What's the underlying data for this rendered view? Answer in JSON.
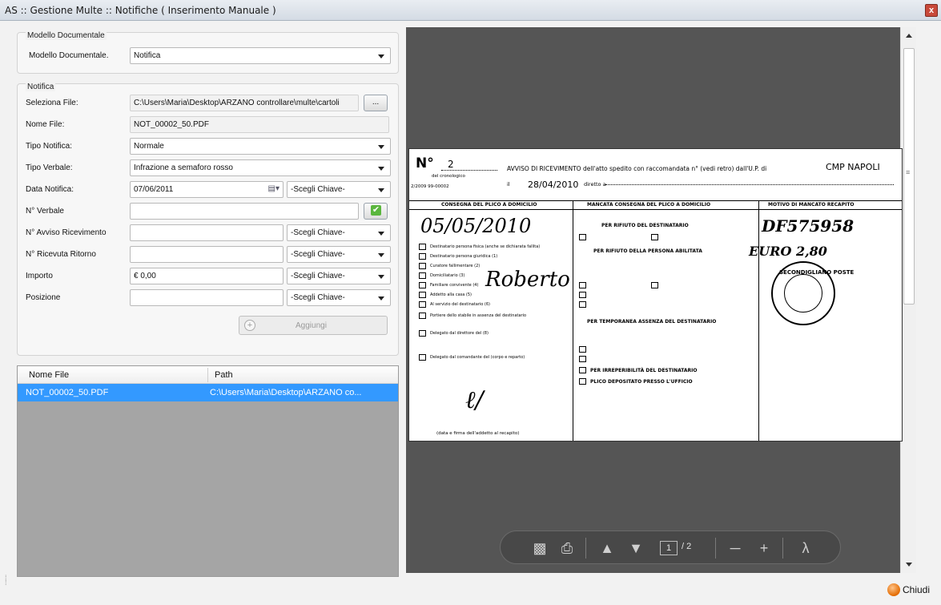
{
  "window": {
    "title": "AS :: Gestione Multe :: Notifiche ( Inserimento Manuale )",
    "close_symbol": "x"
  },
  "modello_group": {
    "title": "Modello Documentale",
    "label": "Modello Documentale.",
    "value": "Notifica"
  },
  "notifica_group": {
    "title": "Notifica",
    "seleziona_file": {
      "label": "Seleziona File:",
      "value": "C:\\Users\\Maria\\Desktop\\ARZANO controllare\\multe\\cartoli",
      "browse_label": "..."
    },
    "nome_file": {
      "label": "Nome File:",
      "value": "NOT_00002_50.PDF"
    },
    "tipo_notifica": {
      "label": "Tipo Notifica:",
      "value": "Normale"
    },
    "tipo_verbale": {
      "label": "Tipo Verbale:",
      "value": "Infrazione a semaforo rosso"
    },
    "data_notifica": {
      "label": "Data Notifica:",
      "value": "07/06/2011",
      "key": "-Scegli Chiave-"
    },
    "n_verbale": {
      "label": "N° Verbale",
      "value": "",
      "check": "✔"
    },
    "n_avviso": {
      "label": "N° Avviso Ricevimento",
      "value": "",
      "key": "-Scegli Chiave-"
    },
    "n_ricevuta": {
      "label": "N° Ricevuta Ritorno",
      "value": "",
      "key": "-Scegli Chiave-"
    },
    "importo": {
      "label": "Importo",
      "value": "€ 0,00",
      "key": "-Scegli Chiave-"
    },
    "posizione": {
      "label": "Posizione",
      "value": "",
      "key": "-Scegli Chiave-"
    },
    "aggiungi_label": "Aggiungi"
  },
  "file_table": {
    "columns": [
      "Nome File",
      "Path"
    ],
    "rows": [
      {
        "nome": "NOT_00002_50.PDF",
        "path": "C:\\Users\\Maria\\Desktop\\ARZANO co..."
      }
    ],
    "selected_color": "#3399ff"
  },
  "document": {
    "n_label": "N°",
    "n_value": "2",
    "cron_label": "del cronologico",
    "code": "2/2009 99-00002",
    "avviso_text": "AVVISO DI RICEVIMENTO dell'atto spedito con raccomandata n° (vedi retro) dall'U.P. di",
    "cmp": "CMP NAPOLI",
    "il_label": "il",
    "date_text": "28/04/2010",
    "diretto": "diretto a",
    "col1_title": "CONSEGNA DEL PLICO A DOMICILIO",
    "col2_title": "MANCATA CONSEGNA DEL PLICO A DOMICILIO",
    "col3_title": "MOTIVO DI MANCATO RECAPITO",
    "handwriting1": "05/05/2010",
    "handwriting2": "Roberto",
    "handwriting3": "DF575958",
    "handwriting4": "EURO 2,80",
    "rifiuto_dest": "PER RIFIUTO DEL DESTINATARIO",
    "rifiuto_pers": "PER RIFIUTO DELLA PERSONA ABILITATA",
    "temp_assenza": "PER TEMPORANEA ASSENZA DEL DESTINATARIO",
    "irreperibilita": "PER IRREPERIBILITÀ DEL DESTINATARIO",
    "plico_depositato": "PLICO DEPOSITATO PRESSO L'UFFICIO",
    "col1_items": [
      "Destinatario persona fisica (anche se dichiarata fallita)",
      "Destinatario persona giuridica (1)",
      "Curatore fallimentare (2)",
      "Domiciliatario (3)",
      "Familiare convivente (4)",
      "Addetto alla casa (5)",
      "Al servizio del destinatario (6)",
      "Portiere dello stabile in assenza del destinatario",
      "Delegato dal direttore del (8)",
      "Delegato dal comandante del (corpo e reparto)"
    ],
    "firma": "(data e firma dell'addetto al recapito)",
    "stamp_text": "SECONDIGLIANO POSTE"
  },
  "viewer_toolbar": {
    "save_icon": "save-icon",
    "print_icon": "print-icon",
    "current_page": "1",
    "total_pages": "/ 2"
  },
  "footer": {
    "chiudi_label": "Chiudi"
  }
}
